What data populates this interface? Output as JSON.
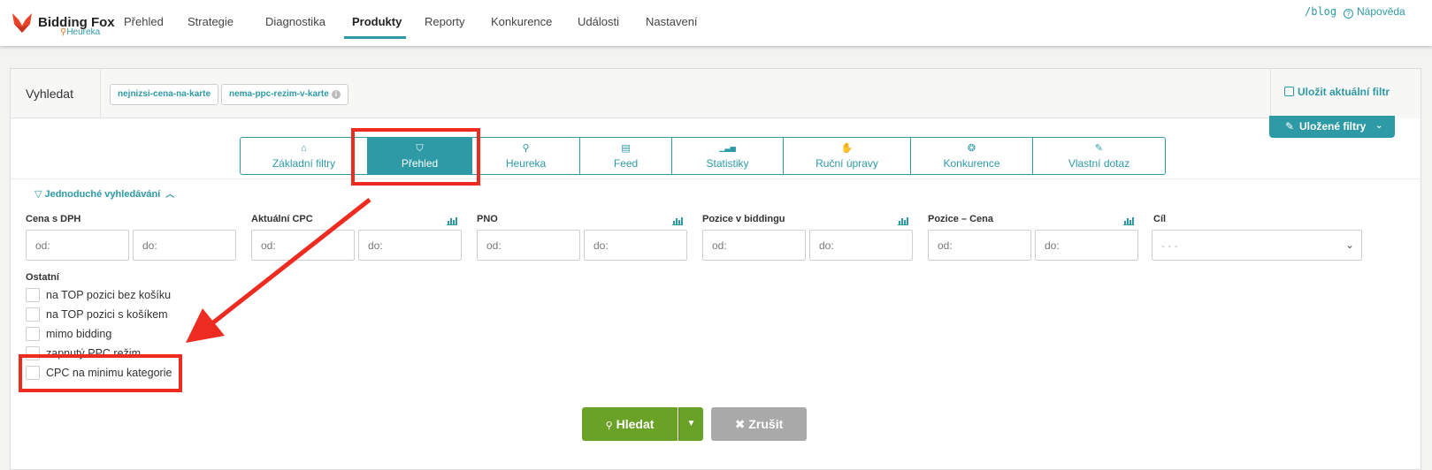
{
  "brand": {
    "name": "Bidding Fox",
    "sub": "Heureka",
    "colors": {
      "accent": "#2d9aa6",
      "fox": "#e8442a",
      "search_button": "#6aa127",
      "cancel_button": "#a9a9a9",
      "annotation": "#ee2b20"
    }
  },
  "nav": {
    "items": [
      {
        "label": "Přehled"
      },
      {
        "label": "Strategie"
      },
      {
        "label": "Diagnostika"
      },
      {
        "label": "Produkty",
        "active": true
      },
      {
        "label": "Reporty"
      },
      {
        "label": "Konkurence"
      },
      {
        "label": "Události"
      },
      {
        "label": "Nastavení"
      }
    ],
    "blog": "/blog",
    "help": "Nápověda"
  },
  "search": {
    "label": "Vyhledat",
    "tags": [
      "nejnizsi-cena-na-karte",
      "nema-ppc-rezim-v-karte"
    ],
    "save_filter": "Uložit aktuální filtr",
    "saved_filters": "Uložené filtry"
  },
  "tabs": [
    {
      "label": "Základní filtry",
      "icon": "home-icon"
    },
    {
      "label": "Přehled",
      "icon": "inbox-icon",
      "active": true
    },
    {
      "label": "Heureka",
      "icon": "search-check-icon"
    },
    {
      "label": "Feed",
      "icon": "list-icon"
    },
    {
      "label": "Statistiky",
      "icon": "bar-chart-icon"
    },
    {
      "label": "Ruční úpravy",
      "icon": "hand-icon"
    },
    {
      "label": "Konkurence",
      "icon": "group-icon"
    },
    {
      "label": "Vlastní dotaz",
      "icon": "pencil-icon"
    }
  ],
  "simple_search": "Jednoduché vyhledávání",
  "filters": [
    {
      "label": "Cena s DPH",
      "from": "od:",
      "to": "do:",
      "chart": false
    },
    {
      "label": "Aktuální CPC",
      "from": "od:",
      "to": "do:",
      "chart": true
    },
    {
      "label": "PNO",
      "from": "od:",
      "to": "do:",
      "chart": true
    },
    {
      "label": "Pozice v biddingu",
      "from": "od:",
      "to": "do:",
      "chart": true
    },
    {
      "label": "Pozice – Cena",
      "from": "od:",
      "to": "do:",
      "chart": true
    }
  ],
  "goal": {
    "label": "Cíl",
    "value": "- - -"
  },
  "others": {
    "label": "Ostatní",
    "options": [
      "na TOP pozici bez košíku",
      "na TOP pozici s košíkem",
      "mimo bidding",
      "zapnutý PPC režim",
      "CPC na minimu kategorie"
    ]
  },
  "buttons": {
    "search": "Hledat",
    "cancel": "Zrušit"
  }
}
